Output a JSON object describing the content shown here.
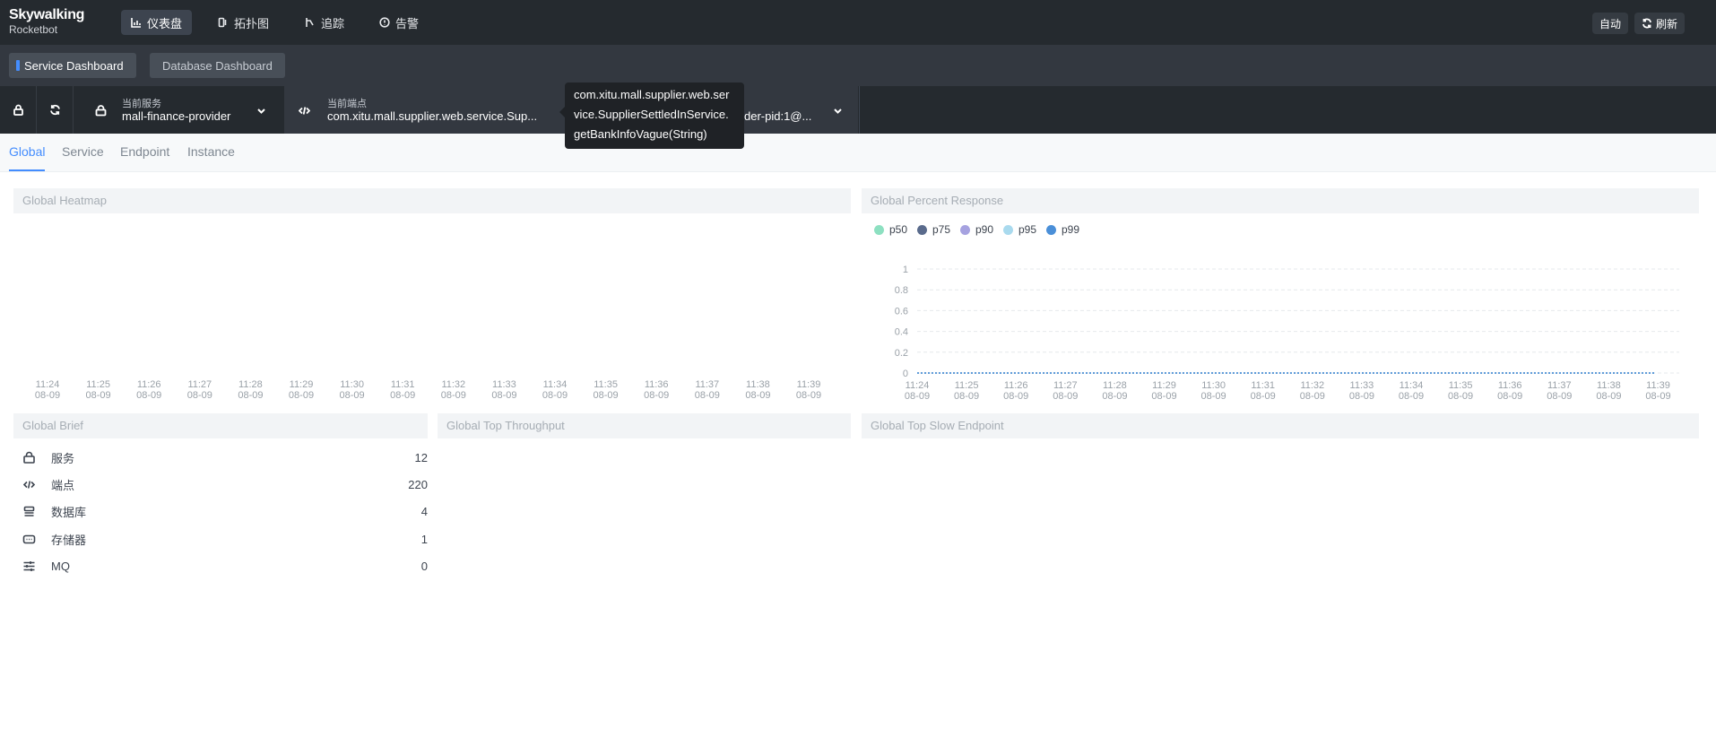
{
  "logo": {
    "name": "Skywalking",
    "sub": "Rocketbot"
  },
  "nav": [
    {
      "label": "仪表盘",
      "icon": "chart-icon",
      "active": true
    },
    {
      "label": "拓扑图",
      "icon": "topology-icon",
      "active": false
    },
    {
      "label": "追踪",
      "icon": "trace-icon",
      "active": false
    },
    {
      "label": "告警",
      "icon": "alarm-icon",
      "active": false
    }
  ],
  "toolbar": {
    "auto_label": "自动",
    "refresh_label": "刷新"
  },
  "dashboards": [
    {
      "label": "Service Dashboard",
      "active": true
    },
    {
      "label": "Database Dashboard",
      "active": false
    }
  ],
  "selectors": {
    "service": {
      "label": "当前服务",
      "value": "mall-finance-provider"
    },
    "endpoint": {
      "label": "当前端点",
      "value": "com.xitu.mall.supplier.web.service.Sup..."
    },
    "instance": {
      "value": "der-pid:1@..."
    }
  },
  "tooltip": {
    "line1": "com.xitu.mall.supplier.web.ser",
    "line2": "vice.SupplierSettledInService.",
    "line3": "getBankInfoVague(String)"
  },
  "page_tabs": [
    "Global",
    "Service",
    "Endpoint",
    "Instance"
  ],
  "panels": {
    "heatmap_title": "Global Heatmap",
    "percent_title": "Global Percent Response",
    "brief_title": "Global Brief",
    "throughput_title": "Global Top Throughput",
    "slow_title": "Global Top Slow Endpoint"
  },
  "time_labels": [
    "11:24",
    "11:25",
    "11:26",
    "11:27",
    "11:28",
    "11:29",
    "11:30",
    "11:31",
    "11:32",
    "11:33",
    "11:34",
    "11:35",
    "11:36",
    "11:37",
    "11:38",
    "11:39"
  ],
  "date_label": "08-09",
  "brief": [
    {
      "label": "服务",
      "value": "12",
      "icon": "service-icon"
    },
    {
      "label": "端点",
      "value": "220",
      "icon": "endpoint-icon"
    },
    {
      "label": "数据库",
      "value": "4",
      "icon": "database-icon"
    },
    {
      "label": "存储器",
      "value": "1",
      "icon": "cache-icon"
    },
    {
      "label": "MQ",
      "value": "0",
      "icon": "mq-icon"
    }
  ],
  "chart_data": {
    "type": "line",
    "x": [
      "11:24",
      "11:25",
      "11:26",
      "11:27",
      "11:28",
      "11:29",
      "11:30",
      "11:31",
      "11:32",
      "11:33",
      "11:34",
      "11:35",
      "11:36",
      "11:37",
      "11:38",
      "11:39"
    ],
    "series": [
      {
        "name": "p50",
        "color": "#8de0c1",
        "values": [
          0,
          0,
          0,
          0,
          0,
          0,
          0,
          0,
          0,
          0,
          0,
          0,
          0,
          0,
          0,
          0
        ]
      },
      {
        "name": "p75",
        "color": "#5a6b8c",
        "values": [
          0,
          0,
          0,
          0,
          0,
          0,
          0,
          0,
          0,
          0,
          0,
          0,
          0,
          0,
          0,
          0
        ]
      },
      {
        "name": "p90",
        "color": "#a6a2e0",
        "values": [
          0,
          0,
          0,
          0,
          0,
          0,
          0,
          0,
          0,
          0,
          0,
          0,
          0,
          0,
          0,
          0
        ]
      },
      {
        "name": "p95",
        "color": "#a9daee",
        "values": [
          0,
          0,
          0,
          0,
          0,
          0,
          0,
          0,
          0,
          0,
          0,
          0,
          0,
          0,
          0,
          0
        ]
      },
      {
        "name": "p99",
        "color": "#4a8fd8",
        "values": [
          0,
          0,
          0,
          0,
          0,
          0,
          0,
          0,
          0,
          0,
          0,
          0,
          0,
          0,
          0,
          0
        ]
      }
    ],
    "yticks": [
      "0",
      "0.2",
      "0.4",
      "0.6",
      "0.8",
      "1"
    ],
    "ylim": [
      0,
      1
    ],
    "grid": true,
    "legend": "top-left"
  }
}
